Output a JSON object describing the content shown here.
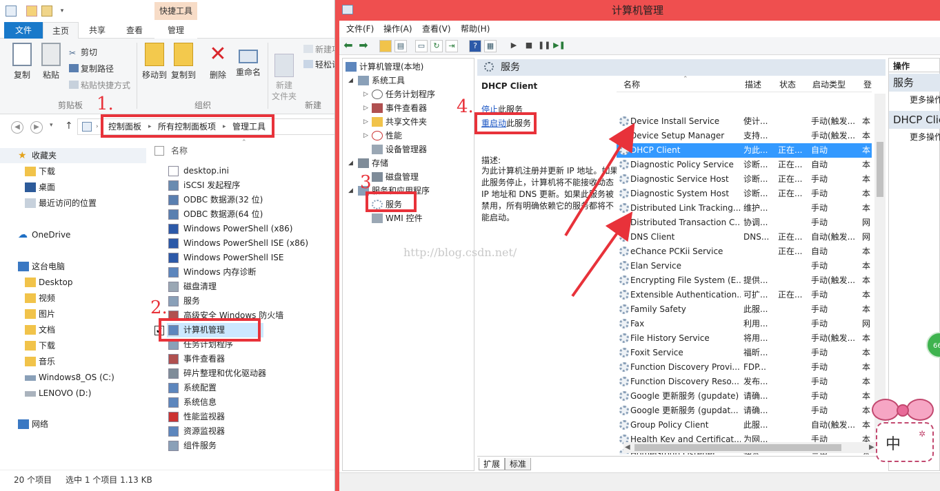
{
  "explorer": {
    "context_tab": "快捷工具",
    "tabs": [
      "文件",
      "主页",
      "共享",
      "查看",
      "管理"
    ],
    "ribbon": {
      "copy": "复制",
      "paste": "粘贴",
      "cut": "剪切",
      "copy_path": "复制路径",
      "paste_shortcut": "粘贴快捷方式",
      "move_to": "移动到",
      "copy_to": "复制到",
      "delete": "删除",
      "rename": "重命名",
      "new_folder": "新建\n文件夹",
      "new_item": "新建项",
      "easy_access": "轻松访",
      "group_clipboard": "剪贴板",
      "group_organize": "组织",
      "group_new": "新建"
    },
    "breadcrumb": [
      "控制面板",
      "所有控制面板项",
      "管理工具"
    ],
    "nav": {
      "favorites": "收藏夹",
      "fav_items": [
        "下载",
        "桌面",
        "最近访问的位置"
      ],
      "onedrive": "OneDrive",
      "this_pc": "这台电脑",
      "pc_items": [
        "Desktop",
        "视频",
        "图片",
        "文档",
        "下载",
        "音乐",
        "Windows8_OS (C:)",
        "LENOVO (D:)"
      ],
      "network": "网络"
    },
    "column_name": "名称",
    "files": [
      "desktop.ini",
      "iSCSI 发起程序",
      "ODBC 数据源(32 位)",
      "ODBC 数据源(64 位)",
      "Windows PowerShell (x86)",
      "Windows PowerShell ISE (x86)",
      "Windows PowerShell ISE",
      "Windows 内存诊断",
      "磁盘清理",
      "服务",
      "高级安全 Windows 防火墙",
      "计算机管理",
      "任务计划程序",
      "事件查看器",
      "碎片整理和优化驱动器",
      "系统配置",
      "系统信息",
      "性能监视器",
      "资源监视器",
      "组件服务"
    ],
    "status_count": "20 个项目",
    "status_selected": "选中 1 个项目 1.13 KB"
  },
  "cm": {
    "title": "计算机管理",
    "menus": [
      "文件(F)",
      "操作(A)",
      "查看(V)",
      "帮助(H)"
    ],
    "tree": {
      "root": "计算机管理(本地)",
      "system_tools": "系统工具",
      "task_scheduler": "任务计划程序",
      "event_viewer": "事件查看器",
      "shared_folders": "共享文件夹",
      "performance": "性能",
      "device_manager": "设备管理器",
      "storage": "存储",
      "disk_management": "磁盘管理",
      "services_apps": "服务和应用程序",
      "services": "服务",
      "wmi": "WMI 控件"
    },
    "panel_title": "服务",
    "selected_service": "DHCP Client",
    "stop_link": "停止",
    "stop_suffix": "此服务",
    "restart_link": "重启动",
    "restart_suffix": "此服务",
    "desc_label": "描述:",
    "desc_text": "为此计算机注册并更新 IP 地址。如果此服务停止，计算机将不能接收动态 IP 地址和 DNS 更新。如果此服务被禁用，所有明确依赖它的服务都将不能启动。",
    "columns": [
      "名称",
      "描述",
      "状态",
      "启动类型",
      "登"
    ],
    "services": [
      {
        "name": "Device Install Service",
        "desc": "使计...",
        "status": "",
        "startup": "手动(触发...",
        "logon": "本"
      },
      {
        "name": "Device Setup Manager",
        "desc": "支持...",
        "status": "",
        "startup": "手动(触发...",
        "logon": "本"
      },
      {
        "name": "DHCP Client",
        "desc": "为此...",
        "status": "正在...",
        "startup": "自动",
        "logon": "本"
      },
      {
        "name": "Diagnostic Policy Service",
        "desc": "诊断...",
        "status": "正在...",
        "startup": "自动",
        "logon": "本"
      },
      {
        "name": "Diagnostic Service Host",
        "desc": "诊断...",
        "status": "正在...",
        "startup": "手动",
        "logon": "本"
      },
      {
        "name": "Diagnostic System Host",
        "desc": "诊断...",
        "status": "正在...",
        "startup": "手动",
        "logon": "本"
      },
      {
        "name": "Distributed Link Tracking...",
        "desc": "维护...",
        "status": "",
        "startup": "手动",
        "logon": "本"
      },
      {
        "name": "Distributed Transaction C...",
        "desc": "协调...",
        "status": "",
        "startup": "手动",
        "logon": "网"
      },
      {
        "name": "DNS Client",
        "desc": "DNS...",
        "status": "正在...",
        "startup": "自动(触发...",
        "logon": "网"
      },
      {
        "name": "eChance PCKii Service",
        "desc": "",
        "status": "正在...",
        "startup": "自动",
        "logon": "本"
      },
      {
        "name": "Elan Service",
        "desc": "",
        "status": "",
        "startup": "手动",
        "logon": "本"
      },
      {
        "name": "Encrypting File System (E...",
        "desc": "提供...",
        "status": "",
        "startup": "手动(触发...",
        "logon": "本"
      },
      {
        "name": "Extensible Authentication...",
        "desc": "可扩...",
        "status": "正在...",
        "startup": "手动",
        "logon": "本"
      },
      {
        "name": "Family Safety",
        "desc": "此服...",
        "status": "",
        "startup": "手动",
        "logon": "本"
      },
      {
        "name": "Fax",
        "desc": "利用...",
        "status": "",
        "startup": "手动",
        "logon": "网"
      },
      {
        "name": "File History Service",
        "desc": "将用...",
        "status": "",
        "startup": "手动(触发...",
        "logon": "本"
      },
      {
        "name": "Foxit Service",
        "desc": "福昕...",
        "status": "",
        "startup": "手动",
        "logon": "本"
      },
      {
        "name": "Function Discovery Provi...",
        "desc": "FDP...",
        "status": "",
        "startup": "手动",
        "logon": "本"
      },
      {
        "name": "Function Discovery Reso...",
        "desc": "发布...",
        "status": "",
        "startup": "手动",
        "logon": "本"
      },
      {
        "name": "Google 更新服务 (gupdate)",
        "desc": "请确...",
        "status": "",
        "startup": "手动",
        "logon": "本"
      },
      {
        "name": "Google 更新服务 (gupdat...",
        "desc": "请确...",
        "status": "",
        "startup": "手动",
        "logon": "本"
      },
      {
        "name": "Group Policy Client",
        "desc": "此服...",
        "status": "",
        "startup": "自动(触发...",
        "logon": "本"
      },
      {
        "name": "Health Key and Certificat...",
        "desc": "为网...",
        "status": "",
        "startup": "手动",
        "logon": "本"
      },
      {
        "name": "HomeGroup Listener",
        "desc": "使本...",
        "status": "",
        "startup": "禁用",
        "logon": "本"
      }
    ],
    "bottom_tabs": [
      "扩展",
      "标准"
    ],
    "actions": {
      "header": "操作",
      "section1": "服务",
      "more1": "更多操作",
      "section2": "DHCP Client",
      "more2": "更多操作"
    }
  },
  "annotations": {
    "n1": "1.",
    "n2": "2.",
    "n3": "3",
    "n4": "4.",
    "watermark": "http://blog.csdn.net/",
    "badge": "66",
    "sticker_char": "中"
  },
  "colors": {
    "accent_red": "#e8323a",
    "file_tab": "#1979ca",
    "selection": "#3399ff",
    "cm_frame": "#ef4f4f"
  }
}
